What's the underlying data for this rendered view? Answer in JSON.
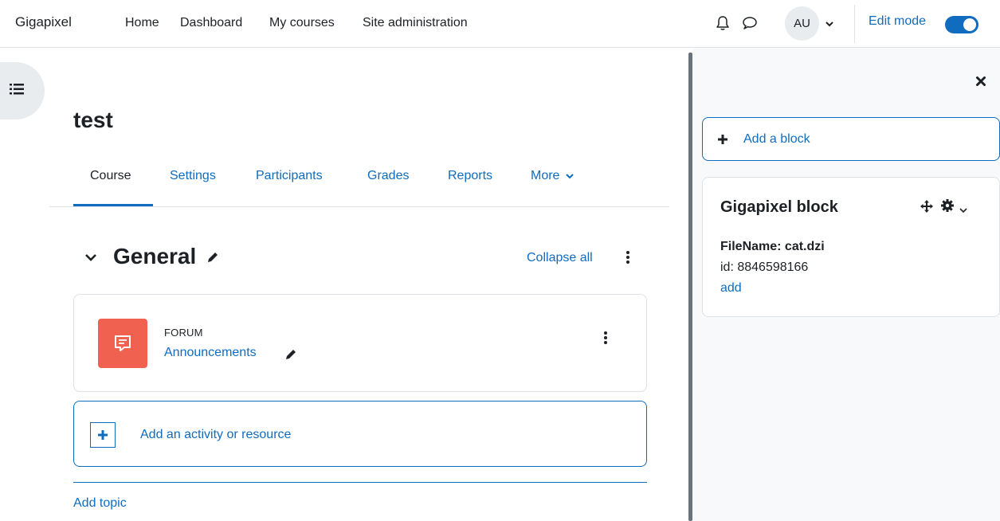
{
  "navbar": {
    "brand": "Gigapixel",
    "links": [
      "Home",
      "Dashboard",
      "My courses",
      "Site administration"
    ],
    "avatar_initials": "AU",
    "edit_mode_label": "Edit mode",
    "edit_mode_on": true,
    "icons": [
      "bell-icon",
      "chat-bubble-icon",
      "chevron-down-icon"
    ]
  },
  "course": {
    "title": "test",
    "tabs": [
      "Course",
      "Settings",
      "Participants",
      "Grades",
      "Reports",
      "More"
    ],
    "active_tab": "Course"
  },
  "section": {
    "title": "General",
    "collapse_label": "Collapse all"
  },
  "activity": {
    "type": "FORUM",
    "name": "Announcements",
    "icon": "forum-icon",
    "icon_color": "#f0624f"
  },
  "add_activity_label": "Add an activity or resource",
  "add_topic_label": "Add topic",
  "drawer": {
    "add_block_label": "Add a block",
    "block": {
      "title": "Gigapixel block",
      "filename": "FileName: cat.dzi",
      "id_text": "id: 8846598166",
      "add_link": "add"
    }
  },
  "colors": {
    "link": "#0f6cbf",
    "text": "#1d2125",
    "border": "#dee2e6",
    "drawer_bg": "#f8f9fa"
  }
}
